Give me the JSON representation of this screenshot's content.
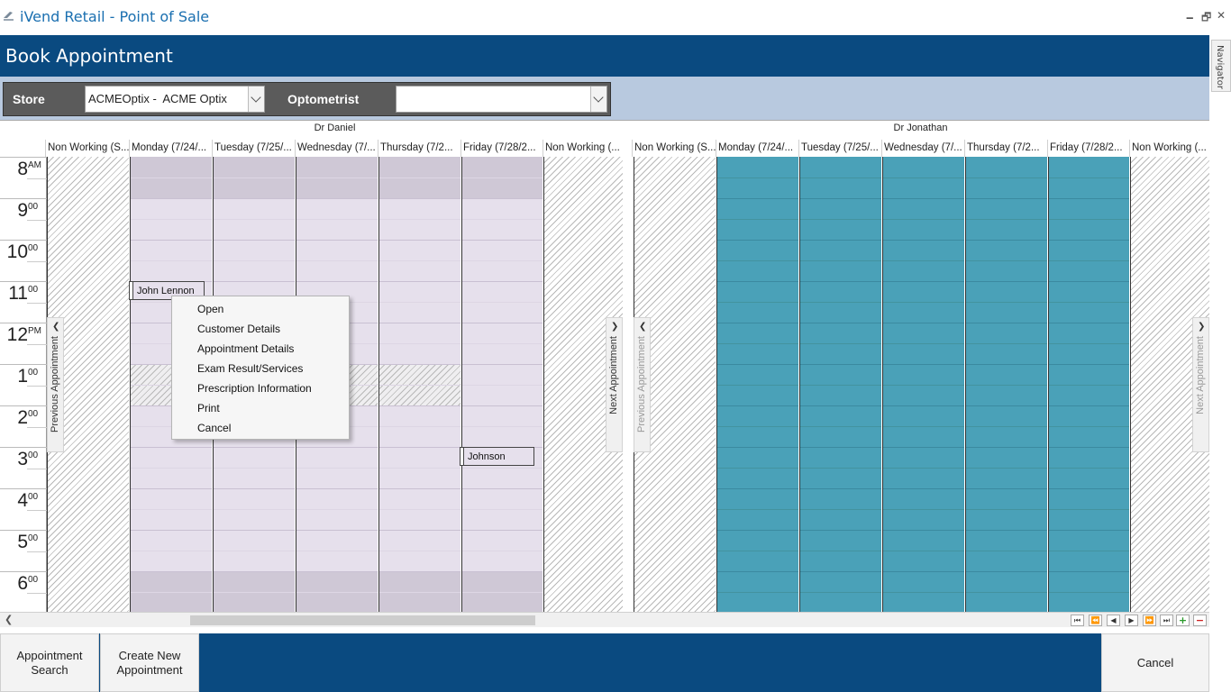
{
  "window": {
    "title": "iVend Retail - Point of Sale",
    "minimize_glyph": "🗕",
    "restore_glyph": "🗗",
    "close_glyph": "✕"
  },
  "header": {
    "title": "Book Appointment"
  },
  "navigator": {
    "label": "Navigator"
  },
  "filters": {
    "store_label": "Store",
    "store_value": "ACMEOptix -  ACME Optix",
    "optometrist_label": "Optometrist",
    "optometrist_value": ""
  },
  "scheduler": {
    "resources": [
      {
        "name": "Dr Daniel",
        "days": [
          "Non Working (S...",
          "Monday (7/24/...",
          "Tuesday (7/25/...",
          "Wednesday (7/...",
          "Thursday (7/2...",
          "Friday (7/28/2...",
          "Non Working (..."
        ]
      },
      {
        "name": "Dr Jonathan",
        "days": [
          "Non Working (S...",
          "Monday (7/24/...",
          "Tuesday (7/25/...",
          "Wednesday (7/...",
          "Thursday (7/2...",
          "Friday (7/28/2...",
          "Non Working (..."
        ]
      }
    ],
    "hours": [
      {
        "num": "8",
        "suffix": "AM"
      },
      {
        "num": "9",
        "suffix": "00"
      },
      {
        "num": "10",
        "suffix": "00"
      },
      {
        "num": "11",
        "suffix": "00"
      },
      {
        "num": "12",
        "suffix": "PM"
      },
      {
        "num": "1",
        "suffix": "00"
      },
      {
        "num": "2",
        "suffix": "00"
      },
      {
        "num": "3",
        "suffix": "00"
      },
      {
        "num": "4",
        "suffix": "00"
      },
      {
        "num": "5",
        "suffix": "00"
      },
      {
        "num": "6",
        "suffix": "00"
      }
    ],
    "appointments": [
      {
        "label": "John Lennon",
        "color": "#9cc25b"
      },
      {
        "label": "Johnson",
        "color": "#d8cde2"
      }
    ],
    "nav": {
      "previous": "Previous Appointment",
      "next": "Next Appointment"
    },
    "colors": {
      "working": "#e6e0ec",
      "off_hours": "#cfc8d6",
      "other_resource": "#4aa1b8"
    }
  },
  "context_menu": {
    "items": [
      "Open",
      "Customer Details",
      "Appointment Details",
      "Exam Result/Services",
      "Prescription Information",
      "Print",
      "Cancel"
    ]
  },
  "pager": {
    "buttons": [
      "⏮",
      "⏪",
      "◀",
      "▶",
      "⏩",
      "⏭",
      "+",
      "−"
    ]
  },
  "footer": {
    "appointment_search": "Appointment Search",
    "create_new": "Create New Appointment",
    "cancel": "Cancel"
  }
}
